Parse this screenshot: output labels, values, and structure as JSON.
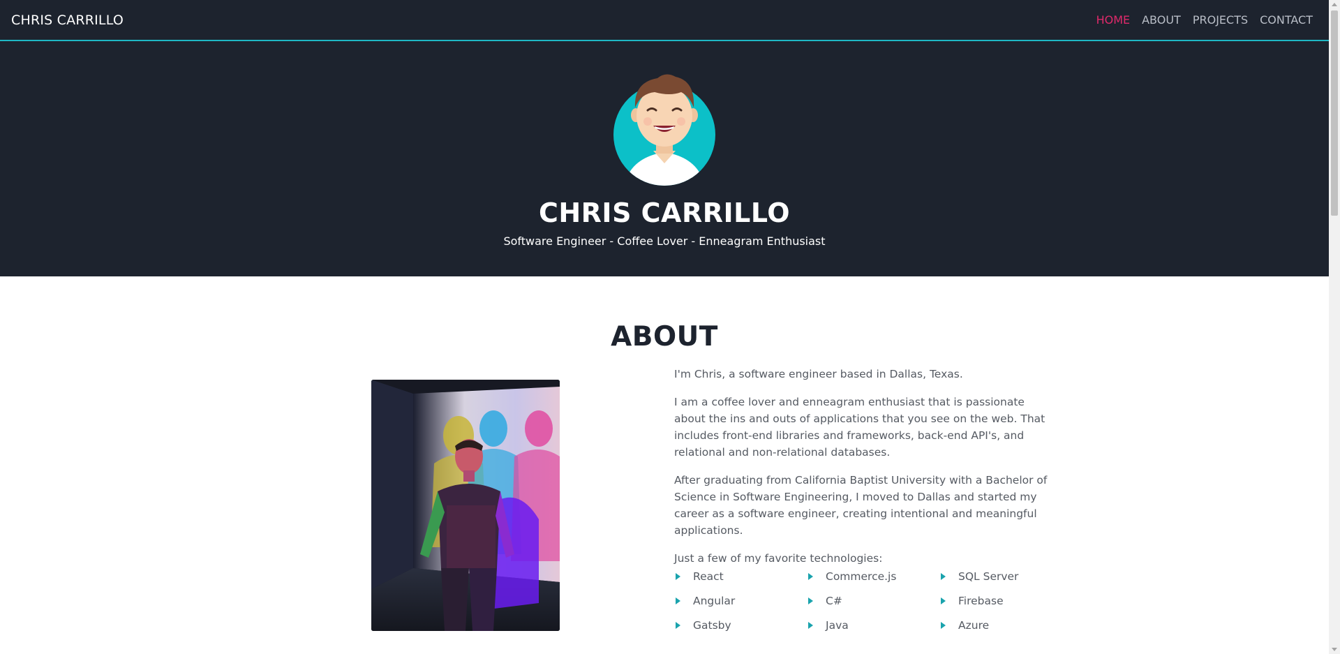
{
  "navbar": {
    "brand": "CHRIS CARRILLO",
    "links": [
      {
        "label": "HOME",
        "active": true
      },
      {
        "label": "ABOUT",
        "active": false
      },
      {
        "label": "PROJECTS",
        "active": false
      },
      {
        "label": "CONTACT",
        "active": false
      }
    ]
  },
  "hero": {
    "name": "CHRIS CARRILLO",
    "tagline": "Software Engineer - Coffee Lover - Enneagram Enthusiast",
    "avatar_icon": "avatar-illustration"
  },
  "about": {
    "title": "ABOUT",
    "paragraphs": [
      "I'm Chris, a software engineer based in Dallas, Texas.",
      "I am a coffee lover and enneagram enthusiast that is passionate about the ins and outs of applications that you see on the web. That includes front-end libraries and frameworks, back-end API's, and relational and non-relational databases.",
      "After graduating from California Baptist University with a Bachelor of Science in Software Engineering, I moved to Dallas and started my career as a software engineer, creating intentional and meaningful applications.",
      "Just a few of my favorite technologies:"
    ],
    "technologies": [
      "React",
      "Commerce.js",
      "SQL Server",
      "Angular",
      "C#",
      "Firebase",
      "Gatsby",
      "Java",
      "Azure"
    ]
  },
  "colors": {
    "nav_bg": "#1d232e",
    "accent_teal": "#1fb8c4",
    "active_link": "#e0296b",
    "bullet": "#1aa3ad"
  }
}
